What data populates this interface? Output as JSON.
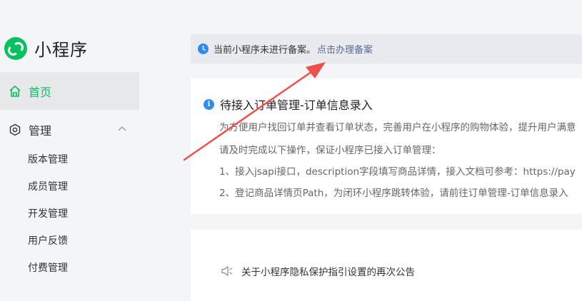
{
  "brand": {
    "title": "小程序",
    "logo_color": "#07c160"
  },
  "nav": {
    "home": "首页",
    "group": "管理",
    "sub_items": [
      "版本管理",
      "成员管理",
      "开发管理",
      "用户反馈",
      "付费管理"
    ]
  },
  "notice": {
    "text": "当前小程序未进行备案。",
    "link": "点击办理备案"
  },
  "task_card": {
    "title": "待接入订单管理-订单信息录入",
    "lines": [
      "为方便用户找回订单并查看订单状态，完善用户在小程序的购物体验，提升用户满意",
      "请及时完成以下操作，保证小程序已接入订单管理：",
      "1、接入jsapi接口，description字段填写商品详情，接入文档可参考：https://pay",
      "2、登记商品详情页Path，为闭环小程序跳转体验，请前往订单管理-订单信息录入"
    ]
  },
  "announcement": {
    "text": "关于小程序隐私保护指引设置的再次公告"
  },
  "colors": {
    "accent": "#07c160",
    "link": "#576b95",
    "annotation_arrow": "#f0504b"
  }
}
